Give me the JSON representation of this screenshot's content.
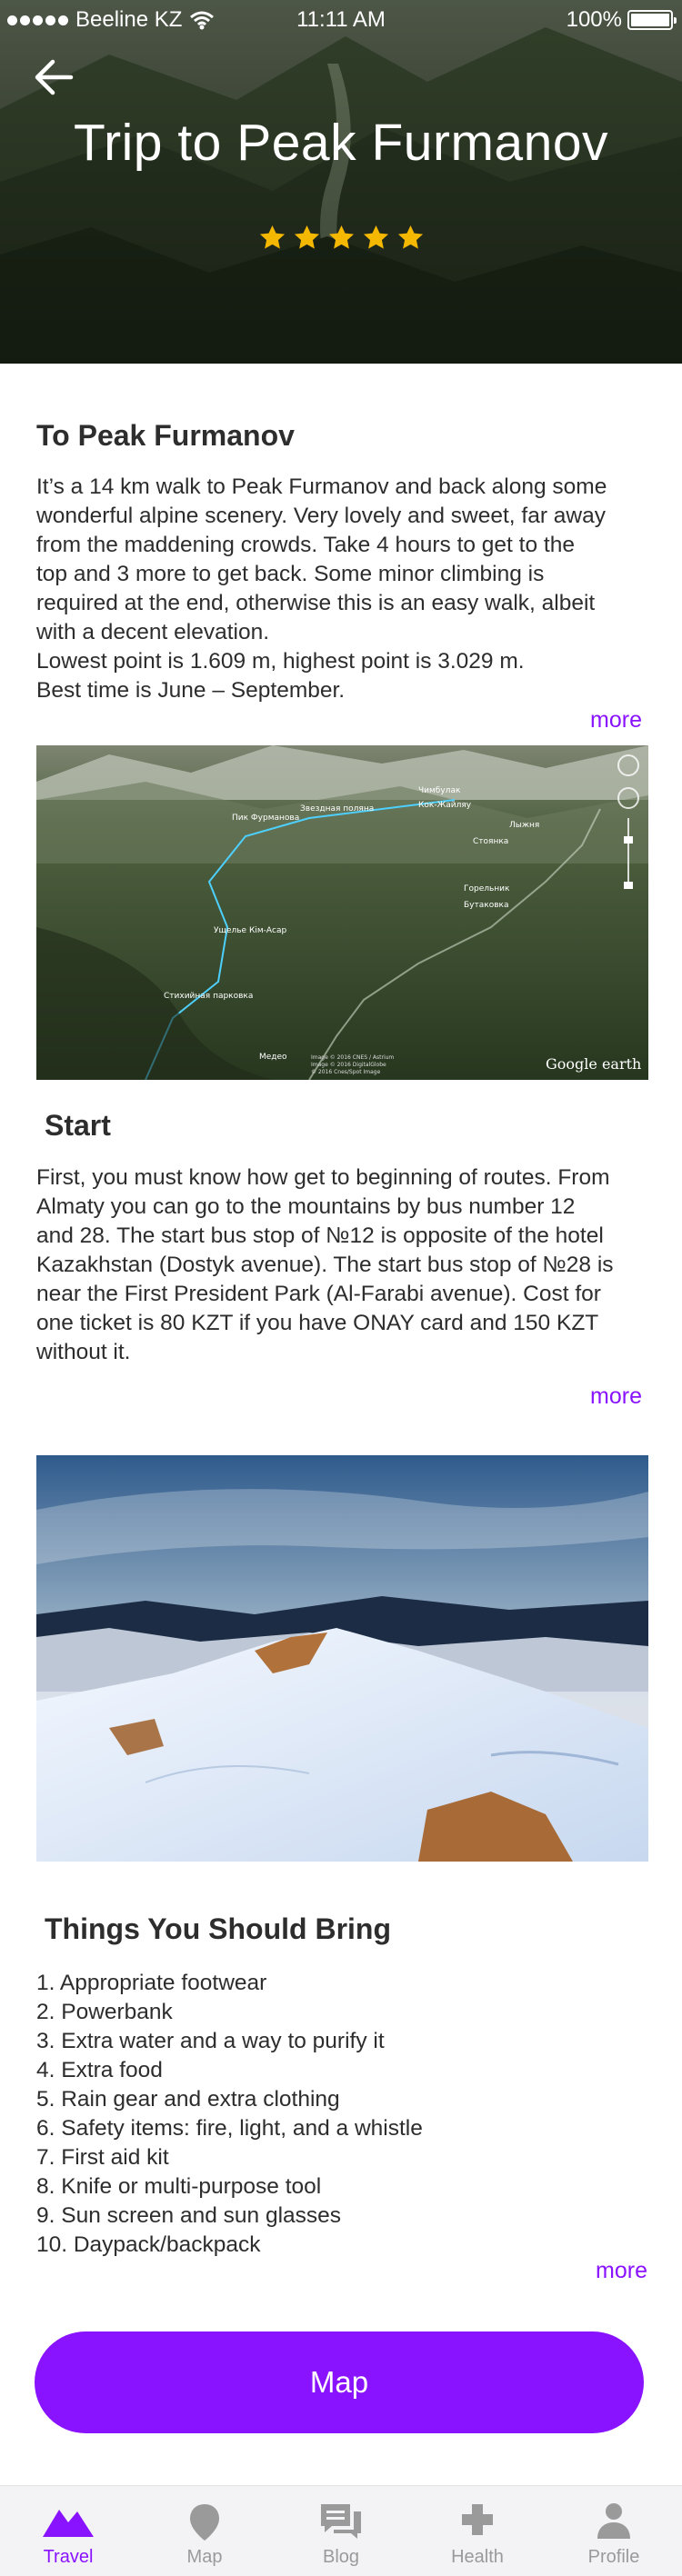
{
  "status_bar": {
    "carrier": "Beeline KZ",
    "time": "11:11 AM",
    "battery": "100%"
  },
  "hero": {
    "title": "Trip to Peak Furmanov",
    "rating": 5,
    "rating_max": 5
  },
  "sections": {
    "intro": {
      "title": "To Peak Furmanov",
      "lines": [
        "It’s a 14 km walk to Peak Furmanov and back along some",
        "wonderful alpine scenery. Very lovely and sweet, far away",
        "from the maddening crowds. Take 4 hours to get to the",
        "top and 3 more to get back. Some minor climbing is",
        "required at the end, otherwise this is an easy walk, albeit",
        "with a decent elevation.",
        "Lowest point is 1.609 m, highest point is 3.029 m.",
        "Best time is June – September."
      ],
      "more": "more"
    },
    "map_image": {
      "brand": "Google earth",
      "labels": [
        "Пик Фурманова",
        "Звездная поляна",
        "Чимбулак",
        "Кок-Жайляу",
        "Ущелье Кім-Асар",
        "Стоянка",
        "Лыжня",
        "Горельник",
        "Бутаковка",
        "Медео",
        "Стихийная парковка"
      ],
      "credit_lines": [
        "Image © 2016 CNES / Astrium",
        "Image © 2016 DigitalGlobe",
        "© 2016 Cnes/Spot Image"
      ]
    },
    "start": {
      "title": "Start",
      "lines": [
        "First, you must know how get to beginning of routes. From",
        "Almaty you can go to the mountains by bus number 12",
        "and 28. The start bus stop of №12 is opposite of the hotel",
        "Kazakhstan (Dostyk avenue). The start bus stop of №28 is",
        "near the First President Park (Al-Farabi avenue). Cost for",
        "one ticket is 80 KZT if you have ONAY card and 150 KZT",
        "without it."
      ],
      "more": "more"
    },
    "bring": {
      "title": "Things You Should Bring",
      "items": [
        "1. Appropriate footwear",
        "2. Powerbank",
        "3. Extra water and a way to purify it",
        "4. Extra food",
        "5. Rain gear and extra clothing",
        "6. Safety items: fire, light, and a whistle",
        "7. First aid kit",
        "8. Knife or multi-purpose tool",
        "9. Sun screen and sun glasses",
        "10. Daypack/backpack"
      ],
      "more": "more"
    }
  },
  "map_button": "Map",
  "tabs": [
    {
      "label": "Travel",
      "icon": "mountain-icon",
      "active": true
    },
    {
      "label": "Map",
      "icon": "location-pin-icon",
      "active": false
    },
    {
      "label": "Blog",
      "icon": "chat-bubbles-icon",
      "active": false
    },
    {
      "label": "Health",
      "icon": "plus-icon",
      "active": false
    },
    {
      "label": "Profile",
      "icon": "person-icon",
      "active": false
    }
  ],
  "colors": {
    "accent": "#8a13ff",
    "star": "#f5b800",
    "text": "#2d2d2d",
    "tab_inactive": "#9a9a9a",
    "tab_bar_bg": "#f3f3f5"
  }
}
